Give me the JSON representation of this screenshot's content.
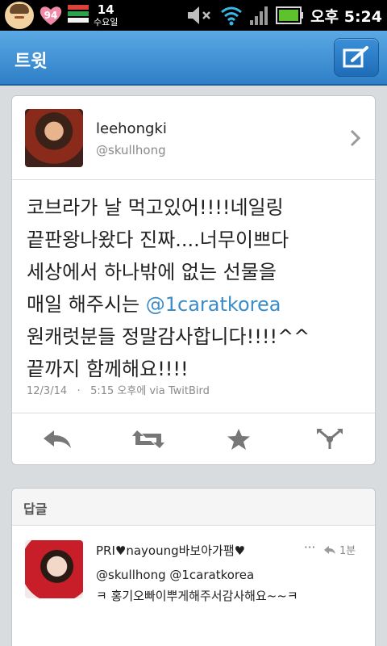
{
  "statusbar": {
    "badge_number": "94",
    "date_day": "14",
    "date_weekday": "수요일",
    "time": "오후 5:24"
  },
  "titlebar": {
    "title": "트윗"
  },
  "tweet": {
    "user_name": "leehongki",
    "user_handle": "@skullhong",
    "text_before_mention": "코브라가 날 먹고있어!!!!네일링\n끝판왕나왔다 진짜....너무이쁘다\n세상에서 하나밖에 없는 선물을\n매일 해주시는 ",
    "mention": "@1caratkorea",
    "text_after_mention": "\n원캐럿분들 정말감사합니다!!!!^^\n끝까지 함께해요!!!!",
    "date": "12/3/14",
    "time_via": "5:15 오후에 via TwitBird"
  },
  "actions": [
    "reply-icon",
    "retweet-icon",
    "favorite-icon",
    "more-icon"
  ],
  "replies": {
    "header": "답글",
    "items": [
      {
        "user": "PRI♥nayoung바보아가팸♥",
        "more": "···",
        "time": "1분",
        "text": "@skullhong @1caratkorea\nㅋ 홍기오빠이뿌게해주서감사해요~~ㅋ"
      }
    ]
  },
  "colors": {
    "titlebar": "#3f8fd6",
    "mention": "#3b8cc8",
    "status_bar": "#000000"
  }
}
